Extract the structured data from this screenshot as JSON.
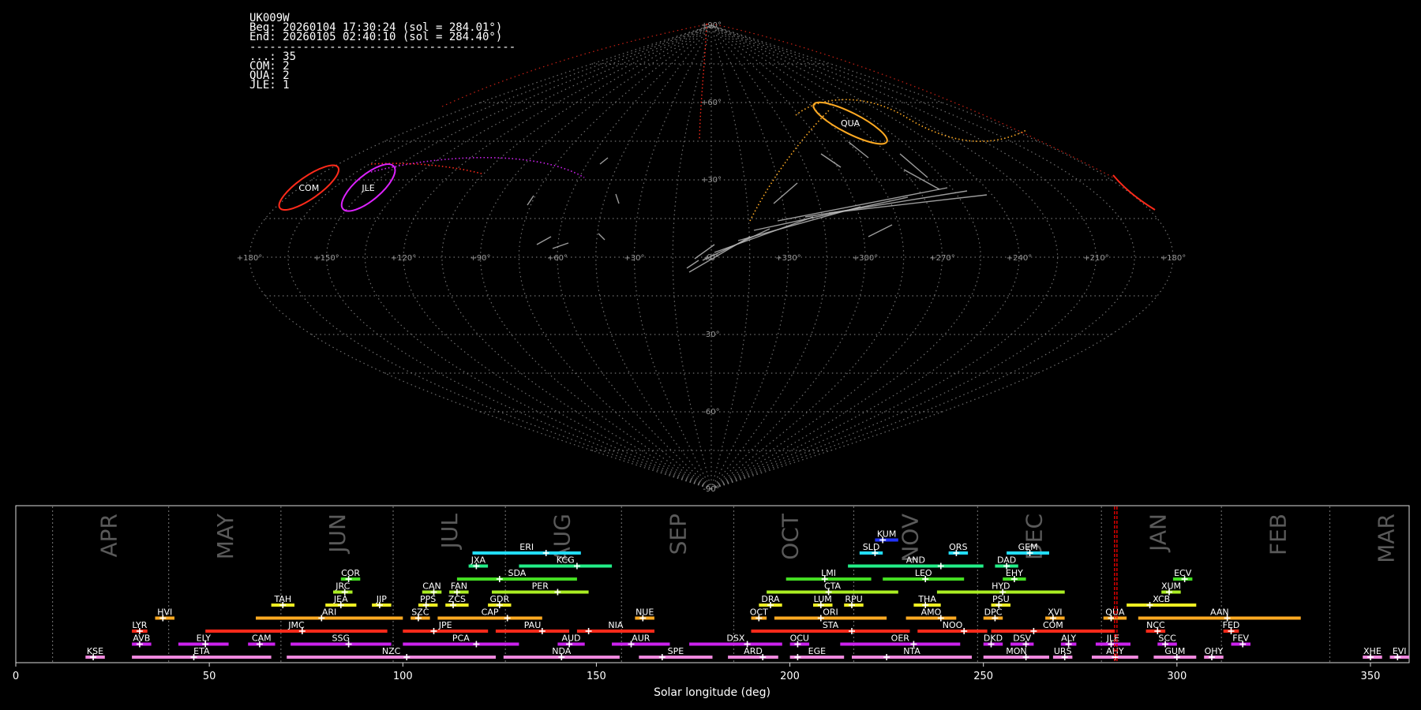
{
  "info": {
    "station": "UK009W",
    "beg": "Beg: 20260104 17:30:24 (sol = 284.01°)",
    "end": "End: 20260105 02:40:10 (sol = 284.40°)",
    "separator": "----------------------------------------",
    "counts": [
      {
        "code": "...",
        "count": 35
      },
      {
        "code": "COM",
        "count": 2
      },
      {
        "code": "QUA",
        "count": 2
      },
      {
        "code": "JLE",
        "count": 1
      }
    ]
  },
  "sky_map": {
    "projection": "sinusoidal",
    "lat_labels": [
      "+90°",
      "+60°",
      "+30°",
      "0°",
      "-30°",
      "-60°",
      "-90°"
    ],
    "lon_labels": [
      "+180°",
      "+150°",
      "+120°",
      "+90°",
      "+60°",
      "+30°",
      "+0°",
      "+330°",
      "+300°",
      "+270°",
      "+240°",
      "+210°",
      "+180°"
    ],
    "showers": [
      {
        "code": "COM",
        "lon": 176,
        "lat": 27,
        "color": "#ff2a1a"
      },
      {
        "code": "JLE",
        "lon": 150,
        "lat": 27,
        "color": "#dd22ff"
      },
      {
        "code": "QUA",
        "lon": 272,
        "lat": 52,
        "color": "#ffaa22"
      }
    ],
    "colors": {
      "grid": "#8a8a8a",
      "sporadic": "#b8b8b8",
      "marker": "#ff0000"
    }
  },
  "chart_data": {
    "type": "bar",
    "xlabel": "Solar longitude (deg)",
    "xlim": [
      0,
      360
    ],
    "xticks": [
      0,
      50,
      100,
      150,
      200,
      250,
      300,
      350
    ],
    "months": [
      {
        "name": "APR",
        "sol": 24
      },
      {
        "name": "MAY",
        "sol": 54
      },
      {
        "name": "JUN",
        "sol": 83
      },
      {
        "name": "JUL",
        "sol": 112
      },
      {
        "name": "AUG",
        "sol": 141
      },
      {
        "name": "SEP",
        "sol": 171
      },
      {
        "name": "OCT",
        "sol": 200
      },
      {
        "name": "NOV",
        "sol": 231
      },
      {
        "name": "DEC",
        "sol": 263
      },
      {
        "name": "JAN",
        "sol": 295
      },
      {
        "name": "FEB",
        "sol": 326
      },
      {
        "name": "MAR",
        "sol": 354
      }
    ],
    "current_sol": 284.2,
    "marker_color": "#ff0000",
    "showers": [
      {
        "code": "KUM",
        "start": 222,
        "end": 228,
        "peak": 224,
        "row": 9,
        "color": "#2233ff"
      },
      {
        "code": "ERI",
        "start": 118,
        "end": 146,
        "peak": 137,
        "row": 8,
        "color": "#22ddff"
      },
      {
        "code": "SLD",
        "start": 218,
        "end": 224,
        "peak": 222,
        "row": 8,
        "color": "#22ddff"
      },
      {
        "code": "ORS",
        "start": 241,
        "end": 246,
        "peak": 243,
        "row": 8,
        "color": "#22ddff"
      },
      {
        "code": "GEM",
        "start": 256,
        "end": 267,
        "peak": 262,
        "row": 8,
        "color": "#22ddff"
      },
      {
        "code": "JXA",
        "start": 117,
        "end": 122,
        "peak": 119,
        "row": 7,
        "color": "#22ee88"
      },
      {
        "code": "KCG",
        "start": 130,
        "end": 154,
        "peak": 145,
        "row": 7,
        "color": "#22ee88"
      },
      {
        "code": "AND",
        "start": 215,
        "end": 250,
        "peak": 239,
        "row": 7,
        "color": "#22ee88"
      },
      {
        "code": "DAD",
        "start": 253,
        "end": 259,
        "peak": 256,
        "row": 7,
        "color": "#22ee88"
      },
      {
        "code": "SDA",
        "start": 114,
        "end": 145,
        "peak": 125,
        "row": 6,
        "color": "#44dd22"
      },
      {
        "code": "COR",
        "start": 84,
        "end": 89,
        "peak": 86,
        "row": 6,
        "color": "#44dd22"
      },
      {
        "code": "LMI",
        "start": 199,
        "end": 221,
        "peak": 209,
        "row": 6,
        "color": "#44dd22"
      },
      {
        "code": "LEO",
        "start": 224,
        "end": 245,
        "peak": 235,
        "row": 6,
        "color": "#44dd22"
      },
      {
        "code": "EHY",
        "start": 255,
        "end": 261,
        "peak": 258,
        "row": 6,
        "color": "#44dd22"
      },
      {
        "code": "ECV",
        "start": 299,
        "end": 304,
        "peak": 302,
        "row": 6,
        "color": "#44dd22"
      },
      {
        "code": "JRC",
        "start": 82,
        "end": 87,
        "peak": 85,
        "row": 5,
        "color": "#aaee22"
      },
      {
        "code": "CAN",
        "start": 105,
        "end": 110,
        "peak": 108,
        "row": 5,
        "color": "#aaee22"
      },
      {
        "code": "FAN",
        "start": 112,
        "end": 117,
        "peak": 114,
        "row": 5,
        "color": "#aaee22"
      },
      {
        "code": "PER",
        "start": 123,
        "end": 148,
        "peak": 140,
        "row": 5,
        "color": "#aaee22"
      },
      {
        "code": "CTA",
        "start": 194,
        "end": 228,
        "peak": 210,
        "row": 5,
        "color": "#aaee22"
      },
      {
        "code": "HYD",
        "start": 238,
        "end": 271,
        "peak": 255,
        "row": 5,
        "color": "#aaee22"
      },
      {
        "code": "XUM",
        "start": 296,
        "end": 301,
        "peak": 298,
        "row": 5,
        "color": "#aaee22"
      },
      {
        "code": "TAH",
        "start": 66,
        "end": 72,
        "peak": 69,
        "row": 4,
        "color": "#eeee22"
      },
      {
        "code": "JEA",
        "start": 80,
        "end": 88,
        "peak": 84,
        "row": 4,
        "color": "#eeee22"
      },
      {
        "code": "JIP",
        "start": 92,
        "end": 97,
        "peak": 94,
        "row": 4,
        "color": "#eeee22"
      },
      {
        "code": "PPS",
        "start": 104,
        "end": 109,
        "peak": 106,
        "row": 4,
        "color": "#eeee22"
      },
      {
        "code": "ZCS",
        "start": 111,
        "end": 117,
        "peak": 113,
        "row": 4,
        "color": "#eeee22"
      },
      {
        "code": "GDR",
        "start": 122,
        "end": 128,
        "peak": 125,
        "row": 4,
        "color": "#eeee22"
      },
      {
        "code": "DRA",
        "start": 192,
        "end": 198,
        "peak": 195,
        "row": 4,
        "color": "#eeee22"
      },
      {
        "code": "LUM",
        "start": 206,
        "end": 211,
        "peak": 208,
        "row": 4,
        "color": "#eeee22"
      },
      {
        "code": "RPU",
        "start": 214,
        "end": 219,
        "peak": 216,
        "row": 4,
        "color": "#eeee22"
      },
      {
        "code": "THA",
        "start": 232,
        "end": 239,
        "peak": 235,
        "row": 4,
        "color": "#eeee22"
      },
      {
        "code": "PSU",
        "start": 252,
        "end": 257,
        "peak": 254,
        "row": 4,
        "color": "#eeee22"
      },
      {
        "code": "XCB",
        "start": 287,
        "end": 305,
        "peak": 293,
        "row": 4,
        "color": "#eeee22"
      },
      {
        "code": "HVI",
        "start": 36,
        "end": 41,
        "peak": 38,
        "row": 3,
        "color": "#ffaa22"
      },
      {
        "code": "ARI",
        "start": 62,
        "end": 100,
        "peak": 79,
        "row": 3,
        "color": "#ffaa22"
      },
      {
        "code": "SZC",
        "start": 102,
        "end": 107,
        "peak": 104,
        "row": 3,
        "color": "#ffaa22"
      },
      {
        "code": "CAP",
        "start": 109,
        "end": 136,
        "peak": 127,
        "row": 3,
        "color": "#ffaa22"
      },
      {
        "code": "NUE",
        "start": 160,
        "end": 165,
        "peak": 162,
        "row": 3,
        "color": "#ffaa22"
      },
      {
        "code": "OCT",
        "start": 190,
        "end": 194,
        "peak": 192,
        "row": 3,
        "color": "#ffaa22"
      },
      {
        "code": "ORI",
        "start": 196,
        "end": 225,
        "peak": 208,
        "row": 3,
        "color": "#ffaa22"
      },
      {
        "code": "AMO",
        "start": 230,
        "end": 243,
        "peak": 239,
        "row": 3,
        "color": "#ffaa22"
      },
      {
        "code": "DPC",
        "start": 250,
        "end": 255,
        "peak": 253,
        "row": 3,
        "color": "#ffaa22"
      },
      {
        "code": "XVI",
        "start": 266,
        "end": 271,
        "peak": 268,
        "row": 3,
        "color": "#ffaa22"
      },
      {
        "code": "QUA",
        "start": 281,
        "end": 287,
        "peak": 283,
        "row": 3,
        "color": "#ffaa22"
      },
      {
        "code": "AAN",
        "start": 290,
        "end": 332,
        "peak": 313,
        "row": 3,
        "color": "#ffaa22"
      },
      {
        "code": "LYR",
        "start": 30,
        "end": 34,
        "peak": 32,
        "row": 2,
        "color": "#ff2a1a"
      },
      {
        "code": "JMC",
        "start": 49,
        "end": 96,
        "peak": 74,
        "row": 2,
        "color": "#ff2a1a"
      },
      {
        "code": "JPE",
        "start": 100,
        "end": 122,
        "peak": 108,
        "row": 2,
        "color": "#ff2a1a"
      },
      {
        "code": "PAU",
        "start": 124,
        "end": 143,
        "peak": 136,
        "row": 2,
        "color": "#ff2a1a"
      },
      {
        "code": "NIA",
        "start": 145,
        "end": 165,
        "peak": 148,
        "row": 2,
        "color": "#ff2a1a"
      },
      {
        "code": "STA",
        "start": 190,
        "end": 231,
        "peak": 216,
        "row": 2,
        "color": "#ff2a1a"
      },
      {
        "code": "NOO",
        "start": 233,
        "end": 251,
        "peak": 245,
        "row": 2,
        "color": "#ff2a1a"
      },
      {
        "code": "COM",
        "start": 252,
        "end": 284,
        "peak": 263,
        "row": 2,
        "color": "#ff2a1a"
      },
      {
        "code": "NCC",
        "start": 292,
        "end": 297,
        "peak": 295,
        "row": 2,
        "color": "#ff2a1a"
      },
      {
        "code": "FED",
        "start": 312,
        "end": 316,
        "peak": 314,
        "row": 2,
        "color": "#ff2a1a"
      },
      {
        "code": "AVB",
        "start": 30,
        "end": 35,
        "peak": 32,
        "row": 1,
        "color": "#cc22ee"
      },
      {
        "code": "ELY",
        "start": 42,
        "end": 55,
        "peak": 49,
        "row": 1,
        "color": "#cc22ee"
      },
      {
        "code": "CAM",
        "start": 60,
        "end": 67,
        "peak": 63,
        "row": 1,
        "color": "#cc22ee"
      },
      {
        "code": "SSG",
        "start": 71,
        "end": 97,
        "peak": 86,
        "row": 1,
        "color": "#cc22ee"
      },
      {
        "code": "PCA",
        "start": 100,
        "end": 130,
        "peak": 119,
        "row": 1,
        "color": "#cc22ee"
      },
      {
        "code": "AUD",
        "start": 140,
        "end": 147,
        "peak": 143,
        "row": 1,
        "color": "#cc22ee"
      },
      {
        "code": "AUR",
        "start": 154,
        "end": 169,
        "peak": 159,
        "row": 1,
        "color": "#cc22ee"
      },
      {
        "code": "DSX",
        "start": 174,
        "end": 198,
        "peak": 189,
        "row": 1,
        "color": "#cc22ee"
      },
      {
        "code": "OCU",
        "start": 200,
        "end": 205,
        "peak": 202,
        "row": 1,
        "color": "#cc22ee"
      },
      {
        "code": "OER",
        "start": 213,
        "end": 244,
        "peak": 232,
        "row": 1,
        "color": "#cc22ee"
      },
      {
        "code": "DKD",
        "start": 250,
        "end": 255,
        "peak": 252,
        "row": 1,
        "color": "#cc22ee"
      },
      {
        "code": "DSV",
        "start": 257,
        "end": 263,
        "peak": 261,
        "row": 1,
        "color": "#cc22ee"
      },
      {
        "code": "ALY",
        "start": 270,
        "end": 274,
        "peak": 272,
        "row": 1,
        "color": "#cc22ee"
      },
      {
        "code": "JLE",
        "start": 279,
        "end": 288,
        "peak": 283,
        "row": 1,
        "color": "#cc22ee"
      },
      {
        "code": "SCC",
        "start": 295,
        "end": 300,
        "peak": 297,
        "row": 1,
        "color": "#cc22ee"
      },
      {
        "code": "FEV",
        "start": 314,
        "end": 319,
        "peak": 317,
        "row": 1,
        "color": "#cc22ee"
      },
      {
        "code": "KSE",
        "start": 18,
        "end": 23,
        "peak": 20,
        "row": 0,
        "color": "#ee88dd"
      },
      {
        "code": "ETA",
        "start": 30,
        "end": 66,
        "peak": 46,
        "row": 0,
        "color": "#ee88dd"
      },
      {
        "code": "NZC",
        "start": 70,
        "end": 124,
        "peak": 101,
        "row": 0,
        "color": "#ee88dd"
      },
      {
        "code": "NDA",
        "start": 126,
        "end": 156,
        "peak": 141,
        "row": 0,
        "color": "#ee88dd"
      },
      {
        "code": "SPE",
        "start": 161,
        "end": 180,
        "peak": 167,
        "row": 0,
        "color": "#ee88dd"
      },
      {
        "code": "ARD",
        "start": 184,
        "end": 197,
        "peak": 193,
        "row": 0,
        "color": "#ee88dd"
      },
      {
        "code": "EGE",
        "start": 200,
        "end": 214,
        "peak": 202,
        "row": 0,
        "color": "#ee88dd"
      },
      {
        "code": "NTA",
        "start": 216,
        "end": 247,
        "peak": 225,
        "row": 0,
        "color": "#ee88dd"
      },
      {
        "code": "MON",
        "start": 250,
        "end": 267,
        "peak": 261,
        "row": 0,
        "color": "#ee88dd"
      },
      {
        "code": "URS",
        "start": 268,
        "end": 273,
        "peak": 271,
        "row": 0,
        "color": "#ee88dd"
      },
      {
        "code": "AHY",
        "start": 278,
        "end": 290,
        "peak": 284,
        "row": 0,
        "color": "#ee88dd"
      },
      {
        "code": "GUM",
        "start": 294,
        "end": 305,
        "peak": 300,
        "row": 0,
        "color": "#ee88dd"
      },
      {
        "code": "OHY",
        "start": 307,
        "end": 312,
        "peak": 309,
        "row": 0,
        "color": "#ee88dd"
      },
      {
        "code": "XHE",
        "start": 348,
        "end": 353,
        "peak": 350,
        "row": 0,
        "color": "#ee88dd"
      },
      {
        "code": "EVI",
        "start": 355,
        "end": 360,
        "peak": 357,
        "row": 0,
        "color": "#ee88dd"
      }
    ]
  }
}
